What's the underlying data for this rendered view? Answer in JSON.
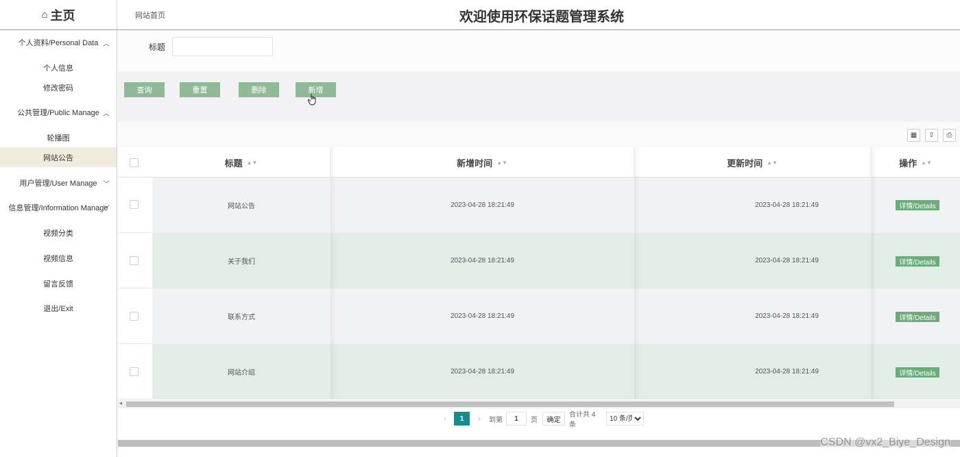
{
  "header": {
    "logo_icon": "home-icon",
    "logo_text": "主页",
    "breadcrumb": "网站首页",
    "title": "欢迎使用环保话题管理系统"
  },
  "sidebar": {
    "groups": [
      {
        "label": "个人资料/Personal Data",
        "expanded": true
      },
      {
        "label": "公共管理/Public Manage",
        "expanded": true
      },
      {
        "label": "用户管理/User Manage",
        "expanded": false
      },
      {
        "label": "信息管理/Information Manage",
        "expanded": false
      }
    ],
    "items": [
      {
        "label": "个人信息"
      },
      {
        "label": "修改密码"
      },
      {
        "label": "轮播图"
      },
      {
        "label": "网站公告",
        "active": true
      },
      {
        "label": "视频分类"
      },
      {
        "label": "视频信息"
      },
      {
        "label": "留言反馈"
      },
      {
        "label": "退出/Exit"
      }
    ]
  },
  "search": {
    "label": "标题",
    "value": ""
  },
  "toolbar": {
    "query_label": "查询",
    "reset_label": "重置",
    "delete_label": "删除",
    "add_label": "新增"
  },
  "table": {
    "columns": [
      "标题",
      "新增时间",
      "更新时间",
      "操作"
    ],
    "rows": [
      {
        "title": "网站公告",
        "created": "2023-04-28 18:21:49",
        "updated": "2023-04-28 18:21:49",
        "action": "详情/Details"
      },
      {
        "title": "关于我们",
        "created": "2023-04-28 18:21:49",
        "updated": "2023-04-28 18:21:49",
        "action": "详情/Details"
      },
      {
        "title": "联系方式",
        "created": "2023-04-28 18:21:49",
        "updated": "2023-04-28 18:21:49",
        "action": "详情/Details"
      },
      {
        "title": "网站介绍",
        "created": "2023-04-28 18:21:49",
        "updated": "2023-04-28 18:21:49",
        "action": "详情/Details"
      }
    ]
  },
  "pagination": {
    "current_page": "1",
    "goto_label": "到第",
    "goto_value": "1",
    "page_unit": "页",
    "confirm_label": "确定",
    "total_label": "合计共 4 条",
    "page_size": "10 条/页"
  },
  "watermark": "CSDN @vx2_Biye_Design",
  "colors": {
    "button_green": "#8fb997",
    "details_green": "#6bab7c",
    "row_alt": "#e1ede6",
    "row_base": "#f1f2f4",
    "page_active": "#1a8a8a",
    "nav_active": "#f2ecdf"
  }
}
